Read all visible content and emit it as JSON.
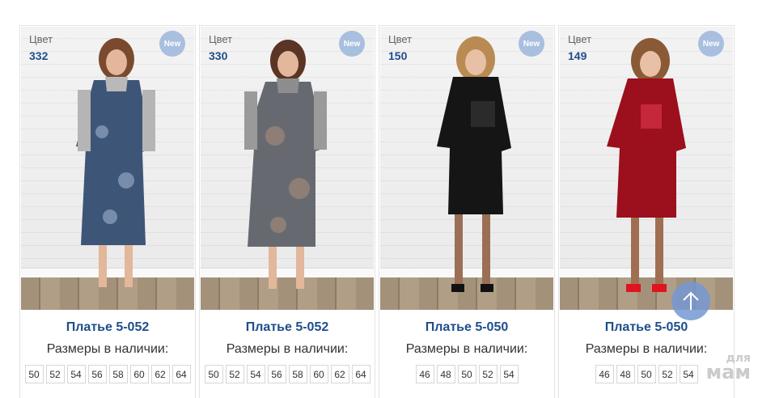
{
  "labels": {
    "color": "Цвет",
    "sizes_available": "Размеры в наличии:",
    "new_badge": "New"
  },
  "products": [
    {
      "color_code": "332",
      "title": "Платье 5-052",
      "sizes": [
        "50",
        "52",
        "54",
        "56",
        "58",
        "60",
        "62",
        "64"
      ]
    },
    {
      "color_code": "330",
      "title": "Платье 5-052",
      "sizes": [
        "50",
        "52",
        "54",
        "56",
        "58",
        "60",
        "62",
        "64"
      ]
    },
    {
      "color_code": "150",
      "title": "Платье 5-050",
      "sizes": [
        "46",
        "48",
        "50",
        "52",
        "54"
      ]
    },
    {
      "color_code": "149",
      "title": "Платье 5-050",
      "sizes": [
        "46",
        "48",
        "50",
        "52",
        "54"
      ]
    }
  ],
  "watermark": {
    "line1": "для",
    "line2": "мам"
  },
  "colors": {
    "accent": "#1f4e8c",
    "badge": "#a9bfe0",
    "scroll_button": "#7698d2"
  }
}
